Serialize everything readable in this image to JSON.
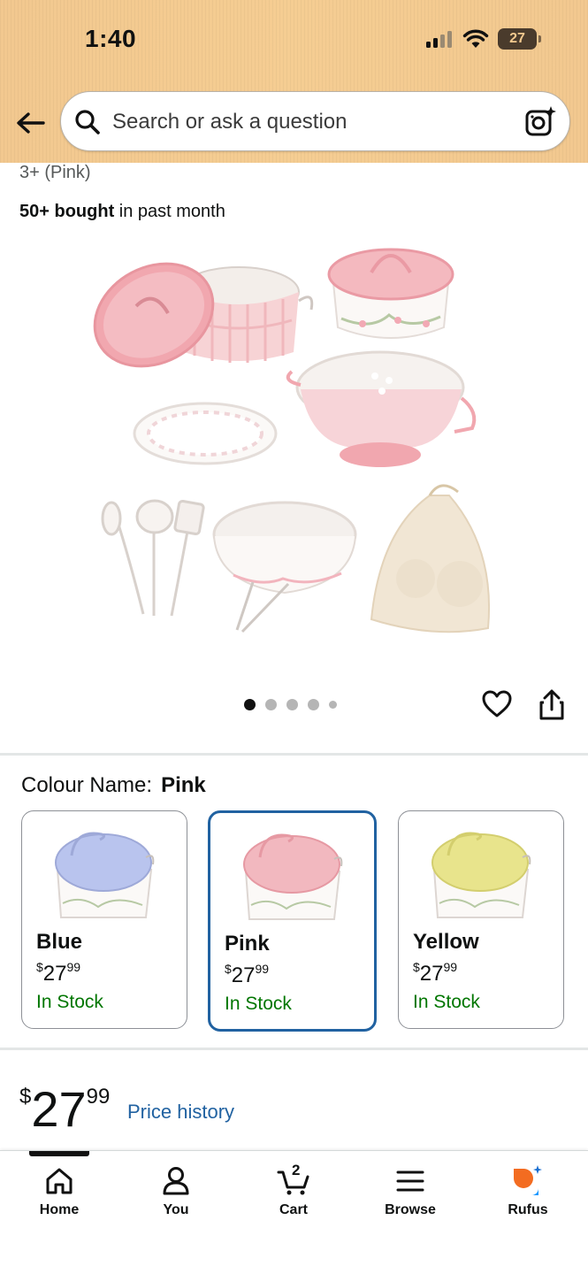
{
  "status_bar": {
    "time": "1:40",
    "battery": "27"
  },
  "search": {
    "placeholder": "Search or ask a question"
  },
  "product": {
    "title_fragment": "3+ (Pink)",
    "bought_bold": "50+ bought",
    "bought_rest": " in past month",
    "image_count": 5,
    "image_index": 1
  },
  "colour": {
    "label": "Colour Name:",
    "selected": "Pink",
    "options": [
      {
        "name": "Blue",
        "currency": "$",
        "whole": "27",
        "cents": "99",
        "stock": "In Stock",
        "lid_color": "#b9c4ee"
      },
      {
        "name": "Pink",
        "currency": "$",
        "whole": "27",
        "cents": "99",
        "stock": "In Stock",
        "lid_color": "#f2b8bf"
      },
      {
        "name": "Yellow",
        "currency": "$",
        "whole": "27",
        "cents": "99",
        "stock": "In Stock",
        "lid_color": "#e8e48c"
      }
    ]
  },
  "price": {
    "currency": "$",
    "whole": "27",
    "cents": "99",
    "history_link": "Price history"
  },
  "nav": {
    "items": [
      {
        "label": "Home",
        "icon": "home-icon"
      },
      {
        "label": "You",
        "icon": "person-icon"
      },
      {
        "label": "Cart",
        "icon": "cart-icon",
        "count": "2"
      },
      {
        "label": "Browse",
        "icon": "menu-icon"
      },
      {
        "label": "Rufus",
        "icon": "rufus-icon"
      }
    ]
  },
  "colors": {
    "header": "#f4cb90",
    "link": "#2162a1",
    "in_stock": "#007600",
    "selected_border": "#2162a1"
  }
}
